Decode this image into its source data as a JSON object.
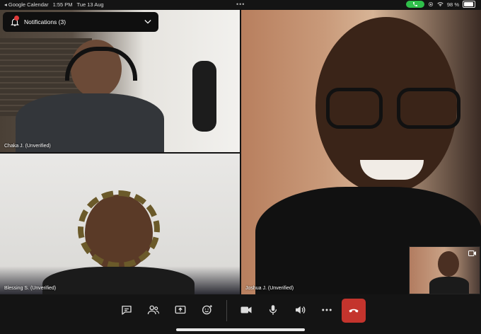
{
  "status": {
    "back_app": "Google Calendar",
    "time": "1:55 PM",
    "date": "Tue 13 Aug",
    "battery": "98 %",
    "battery_level": 0.98
  },
  "notifications": {
    "label": "Notifications (3)",
    "count": "3"
  },
  "participants": [
    {
      "name": "Chaka J. (Unverified)"
    },
    {
      "name": "Blessing S. (Unverified)"
    },
    {
      "name": "Joshua J. (Unverified)"
    }
  ],
  "icons": {
    "chat": "chat-icon",
    "people": "people-icon",
    "share": "share-screen-icon",
    "reactions": "reactions-icon",
    "camera": "camera-icon",
    "mic": "microphone-icon",
    "speaker": "speaker-icon",
    "more": "more-icon",
    "end": "end-call-icon"
  },
  "colors": {
    "end_call": "#c4342d",
    "call_pill": "#2fbf4a",
    "badge": "#e03a3a"
  }
}
